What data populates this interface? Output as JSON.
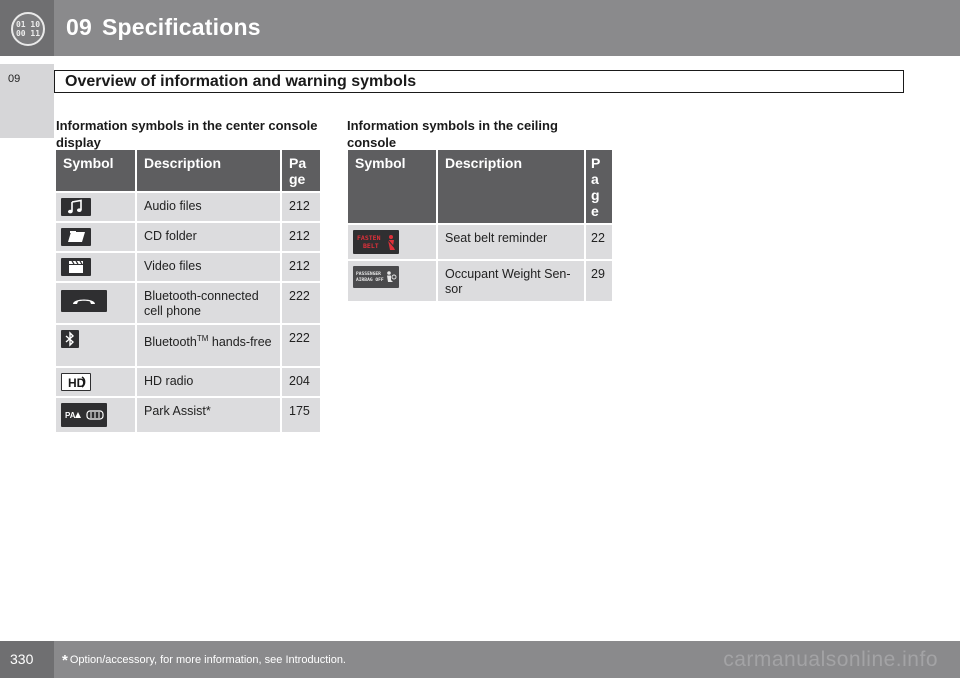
{
  "header": {
    "chapter_number": "09",
    "chapter_title": "Specifications",
    "clock_line1": "01 10",
    "clock_line2": "00 11",
    "clock_icon": "clock-display-icon"
  },
  "side_tab": {
    "number": "09"
  },
  "section": {
    "title": "Overview of information and warning symbols"
  },
  "center_console": {
    "heading": "Information symbols in the center console display",
    "columns": [
      "Symbol",
      "Description",
      "Pa ge"
    ],
    "rows": [
      {
        "icon": "music-note-icon",
        "description": "Audio files",
        "page": "212"
      },
      {
        "icon": "folder-icon",
        "description": "CD folder",
        "page": "212"
      },
      {
        "icon": "clapperboard-icon",
        "description": "Video files",
        "page": "212"
      },
      {
        "icon": "phone-handset-icon",
        "description": "Bluetooth-connected cell phone",
        "page": "222"
      },
      {
        "icon": "bluetooth-icon",
        "description_main": "Bluetooth",
        "description_sup": "TM",
        "description_rest": " hands-free",
        "page": "222"
      },
      {
        "icon": "hd-radio-icon",
        "description": "HD radio",
        "page": "204"
      },
      {
        "icon": "park-assist-icon",
        "description": "Park Assist*",
        "page": "175"
      }
    ]
  },
  "ceiling_console": {
    "heading": "Information symbols in the ceiling console",
    "columns": [
      "Symbol",
      "Description",
      "P a g e"
    ],
    "rows": [
      {
        "icon": "fasten-belt-icon",
        "icon_text_1": "FASTEN",
        "icon_text_2": "BELT",
        "description": "Seat belt reminder",
        "page": "22"
      },
      {
        "icon": "passenger-airbag-off-icon",
        "icon_text_1": "PASSENGER",
        "icon_text_2": "AIRBAG OFF",
        "description": "Occupant Weight Sen-sor",
        "page": "29"
      }
    ]
  },
  "footer": {
    "page_number": "330",
    "star": "*",
    "note": "Option/accessory, for more information, see Introduction.",
    "watermark": "carmanualsonline.info"
  },
  "colors": {
    "header_gray": "#8a8a8c",
    "table_header": "#5e5e60",
    "table_cell": "#dcdcde",
    "warning_red": "#c8202a"
  }
}
